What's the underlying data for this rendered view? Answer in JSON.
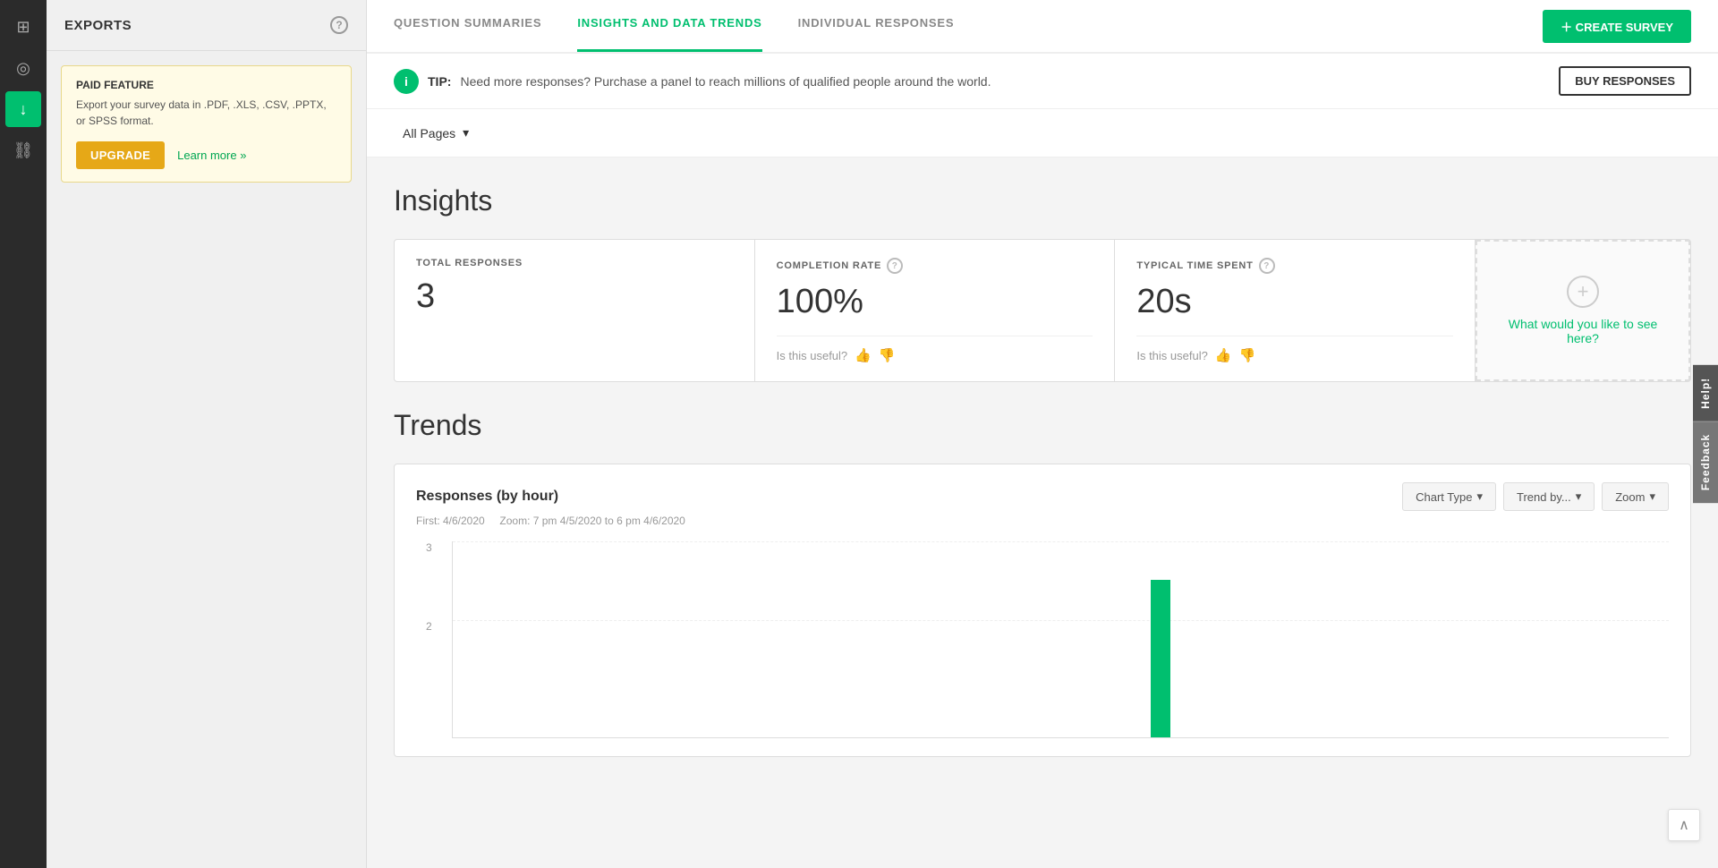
{
  "sidebar": {
    "icons": [
      {
        "name": "filter-icon",
        "symbol": "⊞",
        "active": false
      },
      {
        "name": "eye-icon",
        "symbol": "◎",
        "active": false
      },
      {
        "name": "download-icon",
        "symbol": "↓",
        "active": true
      },
      {
        "name": "link-icon",
        "symbol": "⛓",
        "active": false
      }
    ]
  },
  "exports_panel": {
    "title": "EXPORTS",
    "help_label": "?",
    "paid_feature": {
      "title": "PAID FEATURE",
      "description": "Export your survey data in .PDF, .XLS, .CSV, .PPTX, or SPSS format.",
      "upgrade_label": "UPGRADE",
      "learn_more_label": "Learn more »"
    }
  },
  "tabs": {
    "items": [
      {
        "label": "QUESTION SUMMARIES",
        "active": false
      },
      {
        "label": "INSIGHTS AND DATA TRENDS",
        "active": true
      },
      {
        "label": "INDIVIDUAL RESPONSES",
        "active": false
      }
    ],
    "create_label": "＋ CREATE SURVEY"
  },
  "tip_banner": {
    "icon": "i",
    "label": "TIP:",
    "text": "Need more responses? Purchase a panel to reach millions of qualified people around the world.",
    "button_label": "BUY RESPONSES"
  },
  "pages_filter": {
    "label": "All Pages",
    "arrow": "▾"
  },
  "insights": {
    "section_title": "Insights",
    "metrics": [
      {
        "label": "TOTAL RESPONSES",
        "value": "3",
        "has_feedback": false,
        "has_help": false
      },
      {
        "label": "COMPLETION RATE",
        "value": "100%",
        "has_feedback": true,
        "feedback_text": "Is this useful?"
      },
      {
        "label": "TYPICAL TIME SPENT",
        "value": "20s",
        "has_feedback": true,
        "feedback_text": "Is this useful?"
      }
    ],
    "add_card_text": "What would you like to see here?"
  },
  "trends": {
    "section_title": "Trends",
    "chart_title": "Responses (by hour)",
    "first_label": "First: 4/6/2020",
    "zoom_label": "Zoom: 7 pm 4/5/2020 to 6 pm 4/6/2020",
    "buttons": [
      {
        "label": "Chart Type",
        "arrow": "▾"
      },
      {
        "label": "Trend by...",
        "arrow": "▾"
      },
      {
        "label": "Zoom",
        "arrow": "▾"
      }
    ],
    "chart": {
      "y_labels": [
        "3",
        "2"
      ],
      "bar_height_max": 176,
      "bar_height_2": 88
    }
  },
  "right_edge": {
    "help_label": "Help!",
    "feedback_label": "Feedback"
  },
  "scroll_top_icon": "∧"
}
